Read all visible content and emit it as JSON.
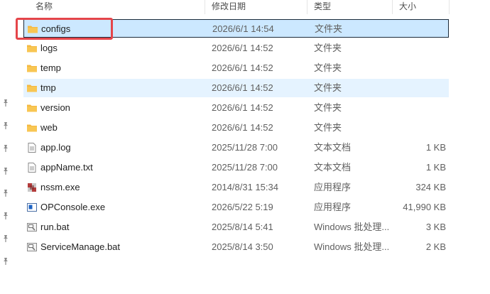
{
  "columns": {
    "name": "名称",
    "modified": "修改日期",
    "type": "类型",
    "size": "大小"
  },
  "files": [
    {
      "name": "configs",
      "modified": "2026/6/1 14:54",
      "type": "文件夹",
      "size": "",
      "icon": "folder-icon",
      "state": "selected"
    },
    {
      "name": "logs",
      "modified": "2026/6/1 14:52",
      "type": "文件夹",
      "size": "",
      "icon": "folder-icon",
      "state": ""
    },
    {
      "name": "temp",
      "modified": "2026/6/1 14:52",
      "type": "文件夹",
      "size": "",
      "icon": "folder-icon",
      "state": ""
    },
    {
      "name": "tmp",
      "modified": "2026/6/1 14:52",
      "type": "文件夹",
      "size": "",
      "icon": "folder-icon",
      "state": "hover"
    },
    {
      "name": "version",
      "modified": "2026/6/1 14:52",
      "type": "文件夹",
      "size": "",
      "icon": "folder-icon",
      "state": ""
    },
    {
      "name": "web",
      "modified": "2026/6/1 14:52",
      "type": "文件夹",
      "size": "",
      "icon": "folder-icon",
      "state": ""
    },
    {
      "name": "app.log",
      "modified": "2025/11/28 7:00",
      "type": "文本文档",
      "size": "1 KB",
      "icon": "text-file-icon",
      "state": ""
    },
    {
      "name": "appName.txt",
      "modified": "2025/11/28 7:00",
      "type": "文本文档",
      "size": "1 KB",
      "icon": "text-file-icon",
      "state": ""
    },
    {
      "name": "nssm.exe",
      "modified": "2014/8/31 15:34",
      "type": "应用程序",
      "size": "324 KB",
      "icon": "nssm-app-icon",
      "state": ""
    },
    {
      "name": "OPConsole.exe",
      "modified": "2026/5/22 5:19",
      "type": "应用程序",
      "size": "41,990 KB",
      "icon": "console-app-icon",
      "state": ""
    },
    {
      "name": "run.bat",
      "modified": "2025/8/14 5:41",
      "type": "Windows 批处理...",
      "size": "3 KB",
      "icon": "batch-file-icon",
      "state": ""
    },
    {
      "name": "ServiceManage.bat",
      "modified": "2025/8/14 3:50",
      "type": "Windows 批处理...",
      "size": "2 KB",
      "icon": "batch-file-icon",
      "state": ""
    }
  ],
  "nav_pins": 8,
  "colors": {
    "selected_bg": "#cce8ff",
    "hover_bg": "#e5f3ff",
    "annotation": "#e5454a",
    "folder": "#f8c653"
  }
}
